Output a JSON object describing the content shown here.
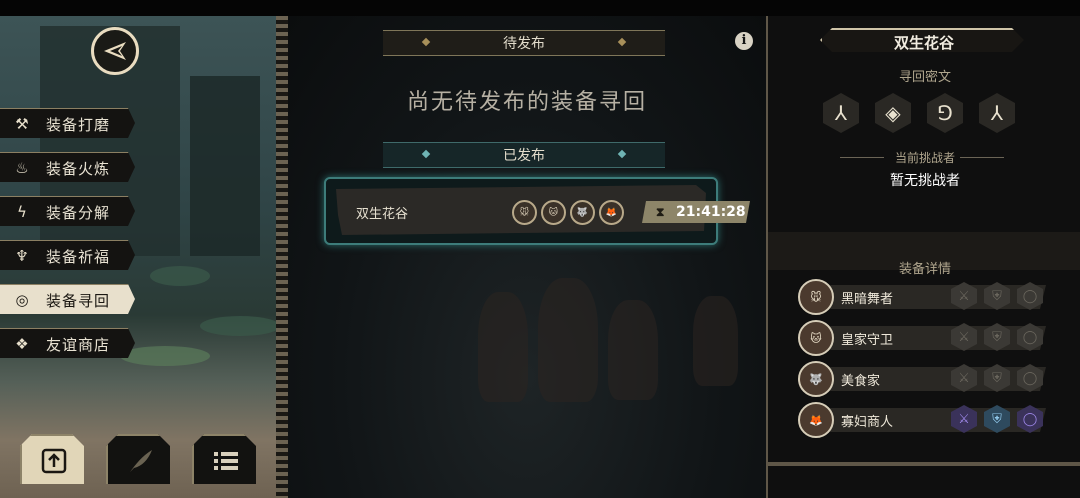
{
  "menu": {
    "items": [
      {
        "label": "装备打磨",
        "icon": "hammer-icon",
        "glyph": "⚒"
      },
      {
        "label": "装备火炼",
        "icon": "flame-icon",
        "glyph": "♨"
      },
      {
        "label": "装备分解",
        "icon": "lightning-icon",
        "glyph": "ϟ"
      },
      {
        "label": "装备祈福",
        "icon": "candles-icon",
        "glyph": "♆"
      },
      {
        "label": "装备寻回",
        "icon": "spiral-icon",
        "glyph": "◎",
        "active": true
      },
      {
        "label": "友谊商店",
        "icon": "fox-icon",
        "glyph": "❖"
      }
    ]
  },
  "center": {
    "pending_header": "待发布",
    "pending_empty": "尚无待发布的装备寻回",
    "published_header": "已发布",
    "published": {
      "name": "双生花谷",
      "timer": "21:41:28",
      "icons": [
        "🐭",
        "🐱",
        "🐺",
        "🦊"
      ]
    }
  },
  "right": {
    "title": "双生花谷",
    "secret_label": "寻回密文",
    "runes": [
      "⅄",
      "◈",
      "⅁",
      "⅄"
    ],
    "challenger_label": "当前挑战者",
    "challenger_value": "暂无挑战者",
    "details_label": "装备详情",
    "heroes": [
      {
        "name": "黑暗舞者",
        "slots": [
          "normal",
          "normal",
          "normal"
        ]
      },
      {
        "name": "皇家守卫",
        "slots": [
          "normal",
          "normal",
          "normal"
        ]
      },
      {
        "name": "美食家",
        "slots": [
          "normal",
          "normal",
          "normal"
        ]
      },
      {
        "name": "寡妇商人",
        "slots": [
          "purple",
          "blue",
          "purple"
        ]
      }
    ]
  },
  "colors": {
    "accent_teal": "#3d7c7a",
    "gold": "#a8905a",
    "timer_bg": "#8d8569"
  }
}
